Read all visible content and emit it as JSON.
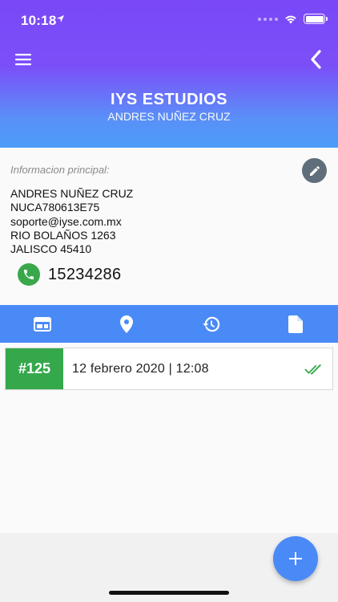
{
  "status_bar": {
    "time": "10:18"
  },
  "header": {
    "title": "IYS ESTUDIOS",
    "subtitle": "ANDRES NUÑEZ CRUZ"
  },
  "info": {
    "label": "Informacion principal:",
    "lines": [
      "ANDRES NUÑEZ CRUZ",
      "NUCA780613E75",
      "soporte@iyse.com.mx",
      "RIO BOLAÑOS 1263",
      "JALISCO  45410"
    ],
    "phone": "15234286"
  },
  "tabs": [
    {
      "icon": "card-icon"
    },
    {
      "icon": "location-pin-icon"
    },
    {
      "icon": "history-icon"
    },
    {
      "icon": "document-icon"
    }
  ],
  "list": [
    {
      "id": "#125",
      "date": "12 febrero 2020 | 12:08",
      "status_icon": "double-check-icon"
    }
  ],
  "colors": {
    "accent": "#4a8af7",
    "purple": "#7a48f7",
    "green": "#35a84b",
    "edit_grey": "#5f6e7a"
  }
}
